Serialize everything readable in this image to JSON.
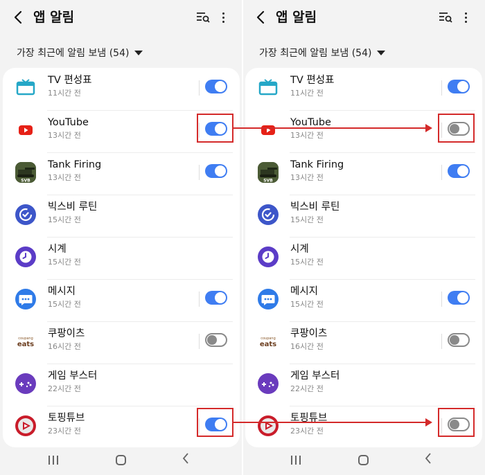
{
  "screens": [
    {
      "id": "before",
      "title": "앱 알림",
      "filter_label": "가장 최근에 알림 보냄 (54)",
      "apps": [
        {
          "name": "TV 편성표",
          "time": "11시간 전",
          "icon": "tv-icon",
          "toggle": true
        },
        {
          "name": "YouTube",
          "time": "13시간 전",
          "icon": "youtube-icon",
          "toggle": true
        },
        {
          "name": "Tank Firing",
          "time": "13시간 전",
          "icon": "tank-firing-icon",
          "toggle": true
        },
        {
          "name": "빅스비 루틴",
          "time": "15시간 전",
          "icon": "bixby-routines-icon",
          "toggle": null
        },
        {
          "name": "시계",
          "time": "15시간 전",
          "icon": "clock-icon",
          "toggle": null
        },
        {
          "name": "메시지",
          "time": "15시간 전",
          "icon": "messages-icon",
          "toggle": true
        },
        {
          "name": "쿠팡이츠",
          "time": "16시간 전",
          "icon": "coupang-eats-icon",
          "toggle": false
        },
        {
          "name": "게임 부스터",
          "time": "22시간 전",
          "icon": "game-booster-icon",
          "toggle": null
        },
        {
          "name": "토핑튜브",
          "time": "23시간 전",
          "icon": "toppingtube-icon",
          "toggle": true
        }
      ]
    },
    {
      "id": "after",
      "title": "앱 알림",
      "filter_label": "가장 최근에 알림 보냄 (54)",
      "apps": [
        {
          "name": "TV 편성표",
          "time": "11시간 전",
          "icon": "tv-icon",
          "toggle": true
        },
        {
          "name": "YouTube",
          "time": "13시간 전",
          "icon": "youtube-icon",
          "toggle": false
        },
        {
          "name": "Tank Firing",
          "time": "13시간 전",
          "icon": "tank-firing-icon",
          "toggle": true
        },
        {
          "name": "빅스비 루틴",
          "time": "15시간 전",
          "icon": "bixby-routines-icon",
          "toggle": null
        },
        {
          "name": "시계",
          "time": "15시간 전",
          "icon": "clock-icon",
          "toggle": null
        },
        {
          "name": "메시지",
          "time": "15시간 전",
          "icon": "messages-icon",
          "toggle": true
        },
        {
          "name": "쿠팡이츠",
          "time": "16시간 전",
          "icon": "coupang-eats-icon",
          "toggle": false
        },
        {
          "name": "게임 부스터",
          "time": "22시간 전",
          "icon": "game-booster-icon",
          "toggle": null
        },
        {
          "name": "토핑튜브",
          "time": "23시간 전",
          "icon": "toppingtube-icon",
          "toggle": false
        }
      ]
    }
  ],
  "icon_labels": {
    "tank": "SVB",
    "coupang_top": "coupang",
    "coupang_main": "eats"
  },
  "colors": {
    "accent": "#3f7df2",
    "annotation": "#d42a2a",
    "background": "#f3f3f3"
  }
}
